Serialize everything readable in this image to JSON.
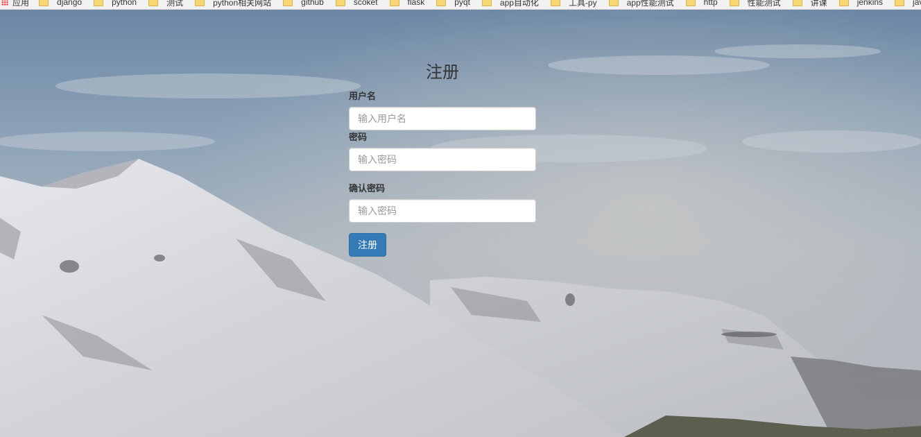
{
  "bookmarks": {
    "apps_label": "应用",
    "items": [
      "django",
      "python",
      "测试",
      "python相关网站",
      "github",
      "scoket",
      "flask",
      "pyqt",
      "app自动化",
      "工具-py",
      "app性能测试",
      "http",
      "性能测试",
      "讲课",
      "jenkins",
      "java"
    ]
  },
  "form": {
    "title": "注册",
    "username_label": "用户名",
    "username_placeholder": "输入用户名",
    "password_label": "密码",
    "password_placeholder": "输入密码",
    "confirm_label": "确认密码",
    "confirm_placeholder": "输入密码",
    "submit_label": "注册"
  },
  "colors": {
    "button": "#337ab7",
    "bookmark_bar": "#f2f2f2"
  }
}
